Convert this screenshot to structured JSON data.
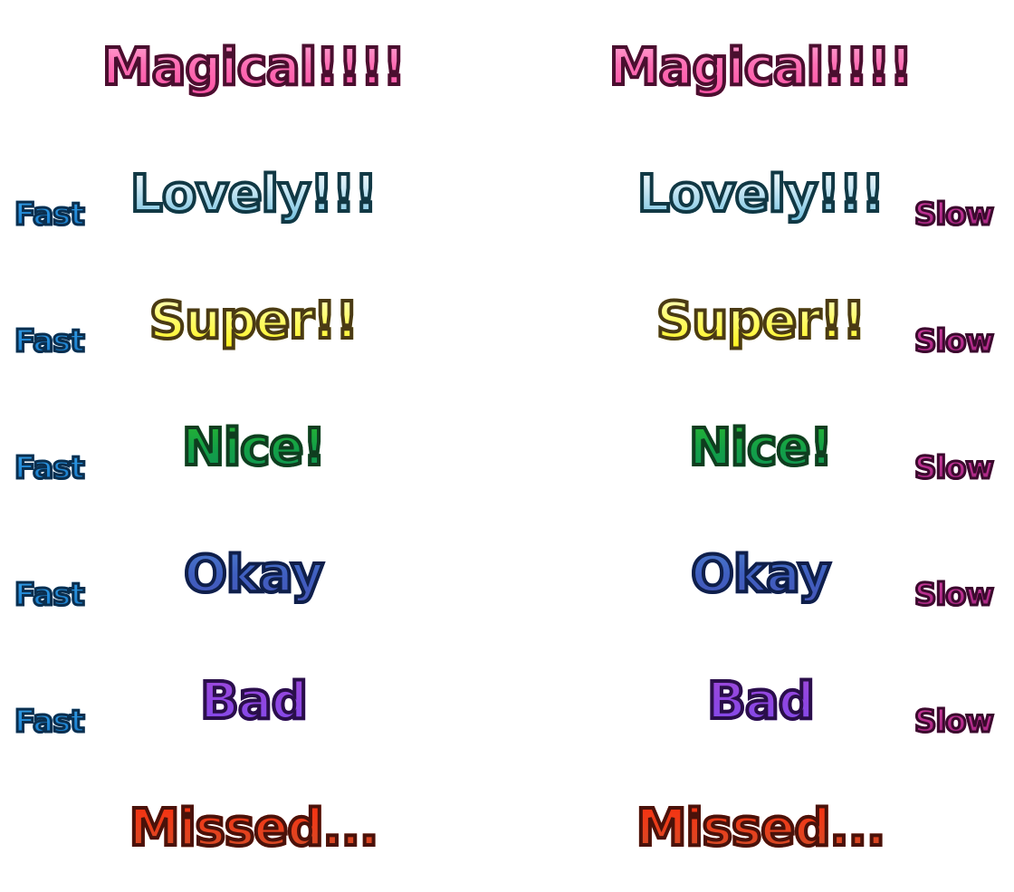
{
  "judgements": {
    "magical": "Magical!!!!",
    "lovely": "Lovely!!!",
    "super": "Super!!",
    "nice": "Nice!",
    "okay": "Okay",
    "bad": "Bad",
    "missed": "Missed..."
  },
  "timing": {
    "fast": "Fast",
    "slow": "Slow"
  },
  "colors": {
    "magical": "#ff4aa0",
    "lovely": "#59b6da",
    "super": "#ffee00",
    "nice": "#13a047",
    "okay": "#3f5fc0",
    "bad": "#8f46e2",
    "missed": "#e83f1c",
    "fast": "#1f86d4",
    "slow": "#b22b8a"
  }
}
